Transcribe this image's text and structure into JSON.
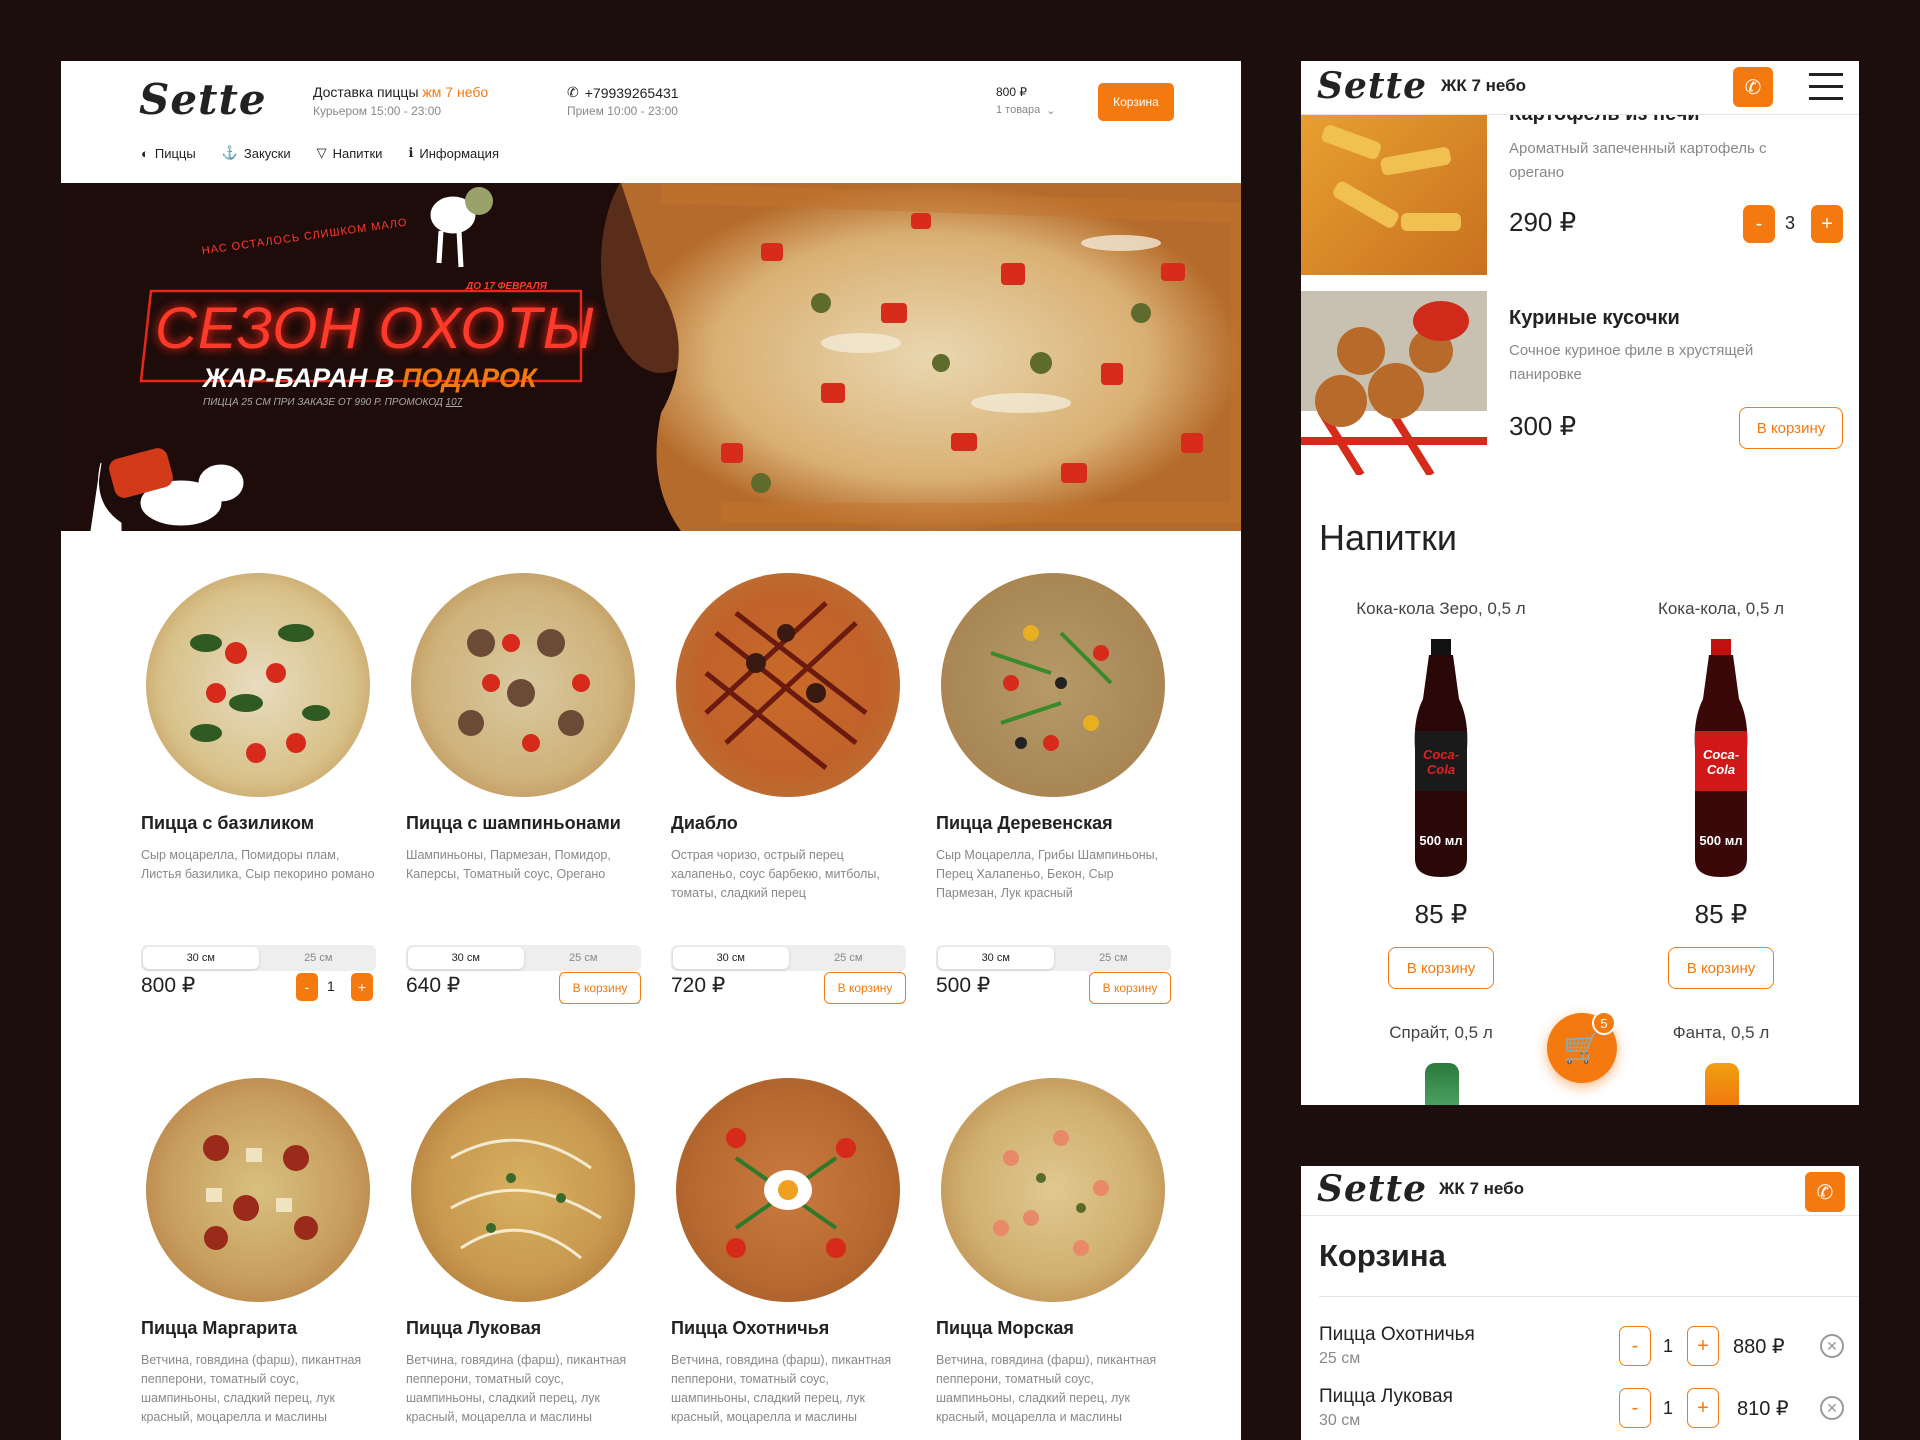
{
  "desktop": {
    "logo": "Sette",
    "delivery_prefix": "Доставка пиццы ",
    "delivery_location": "жм 7 небо",
    "courier_hours": "Курьером 15:00 - 23:00",
    "phone": "+79939265431",
    "phone_hours": "Прием 10:00 - 23:00",
    "cart_total": "800 ₽",
    "cart_count": "1 товара",
    "cart_button": "Корзина",
    "nav": [
      {
        "label": "Пиццы",
        "icon": "pizza-icon"
      },
      {
        "label": "Закуски",
        "icon": "cutlery-icon"
      },
      {
        "label": "Напитки",
        "icon": "cocktail-icon"
      },
      {
        "label": "Информация",
        "icon": "info-icon"
      }
    ],
    "banner": {
      "tagline": "НАС ОСТАЛОСЬ СЛИШКОМ МАЛО",
      "date": "ДО 17 ФЕВРАЛЯ",
      "title": "СЕЗОН ОХОТЫ",
      "subtitle_a": "ЖАР-БАРАН В ",
      "subtitle_b": "ПОДАРОК",
      "fine_print_a": "ПИЦЦА 25 СМ ПРИ ЗАКАЗЕ ОТ 990 Р. ПРОМОКОД ",
      "fine_print_b": "107"
    },
    "size_options": [
      "30 см",
      "25 см"
    ],
    "add_button": "В корзину",
    "pizzas": [
      {
        "name": "Пицца с базиликом",
        "desc": "Сыр моцарелла, Помидоры плам, Листья базилика, Сыр пекорино романо",
        "price": "800 ₽",
        "qty": "1"
      },
      {
        "name": "Пицца с шампиньонами",
        "desc": "Шампиньоны, Пармезан, Помидор, Каперсы, Томатный соус, Орегано",
        "price": "640 ₽"
      },
      {
        "name": "Диабло",
        "desc": "Острая чоризо, острый перец халапеньо, соус барбекю, митболы, томаты, сладкий перец",
        "price": "720 ₽"
      },
      {
        "name": "Пицца Деревенская",
        "desc": "Сыр Моцарелла, Грибы Шампиньоны, Перец Халапеньо, Бекон, Сыр Пармезан, Лук красный",
        "price": "500 ₽"
      },
      {
        "name": "Пицца Маргарита",
        "desc": "Ветчина, говядина (фарш), пикантная пепперони, томатный соус, шампиньоны, сладкий перец, лук красный, моцарелла и маслины"
      },
      {
        "name": "Пицца Луковая",
        "desc": "Ветчина, говядина (фарш), пикантная пепперони, томатный соус, шампиньоны, сладкий перец, лук красный, моцарелла и маслины"
      },
      {
        "name": "Пицца Охотничья",
        "desc": "Ветчина, говядина (фарш), пикантная пепперони, томатный соус, шампиньоны, сладкий перец, лук красный, моцарелла и маслины"
      },
      {
        "name": "Пицца Морская",
        "desc": "Ветчина, говядина (фарш), пикантная пепперони, томатный соус, шампиньоны, сладкий перец, лук красный, моцарелла и маслины"
      }
    ]
  },
  "mobile": {
    "logo": "Sette",
    "location": "ЖК 7 небо",
    "snacks": [
      {
        "name": "Картофель из печи",
        "desc": "Ароматный запеченный картофель с орегано",
        "price": "290 ₽",
        "qty": "3"
      },
      {
        "name": "Куриные кусочки",
        "desc": "Сочное куриное филе в хрустящей панировке",
        "price": "300 ₽"
      }
    ],
    "add_button": "В корзину",
    "drinks_heading": "Напитки",
    "drinks": [
      {
        "name": "Кока-кола Зеро, 0,5 л",
        "price": "85 ₽",
        "brand": "Coca-Cola",
        "volume": "500 мл"
      },
      {
        "name": "Кока-кола, 0,5 л",
        "price": "85 ₽",
        "brand": "Coca-Cola",
        "volume": "500 мл"
      },
      {
        "name": "Спрайт, 0,5 л"
      },
      {
        "name": "Фанта, 0,5 л"
      }
    ],
    "cart_badge": "5"
  },
  "cart": {
    "logo": "Sette",
    "location": "ЖК 7 небо",
    "title": "Корзина",
    "items": [
      {
        "name": "Пицца Охотничья",
        "size": "25 см",
        "qty": "1",
        "price": "880 ₽"
      },
      {
        "name": "Пицца Луковая",
        "size": "30 см",
        "qty": "1",
        "price": "810 ₽"
      }
    ]
  },
  "colors": {
    "accent": "#f47a10",
    "background": "#1c0e0d",
    "neon": "#ff2a1a"
  }
}
